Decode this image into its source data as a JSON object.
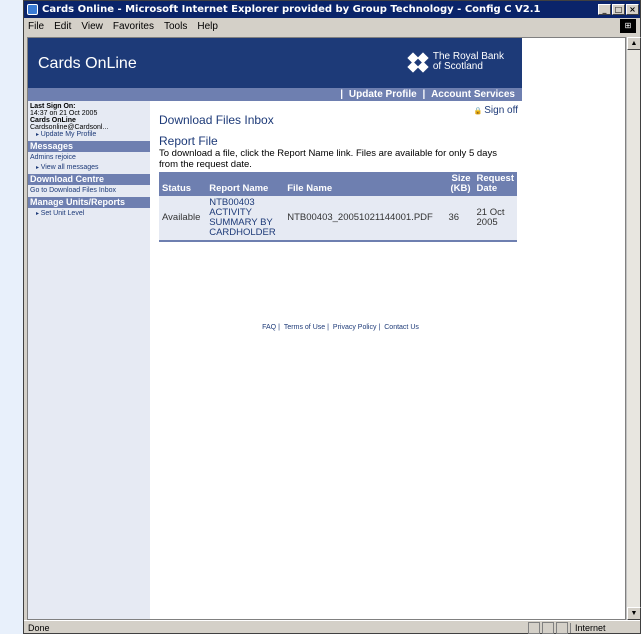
{
  "window": {
    "title": "Cards Online - Microsoft Internet Explorer provided by Group Technology - Config C V2.1"
  },
  "menu": [
    "File",
    "Edit",
    "View",
    "Favorites",
    "Tools",
    "Help"
  ],
  "header": {
    "app_name": "Cards OnLine",
    "bank_name_line1": "The Royal Bank",
    "bank_name_line2": "of Scotland"
  },
  "nav": {
    "update_profile": "Update Profile",
    "account_services": "Account Services"
  },
  "sidebar": {
    "last_sign_on_label": "Last Sign On:",
    "last_sign_on_value": "14:37 on 21 Oct 2005",
    "product": "Cards OnLine",
    "email": "Cardsonline@Cardsonl...",
    "update_my_profile": "Update My Profile",
    "messages_heading": "Messages",
    "messages_item": "Admins rejoice",
    "view_all_messages": "View all messages",
    "download_heading": "Download Centre",
    "download_link": "Go to Download Files Inbox",
    "manage_heading": "Manage Units/Reports",
    "set_unit_level": "Set Unit Level"
  },
  "main": {
    "sign_off": "Sign off",
    "page_title": "Download Files Inbox",
    "section_title": "Report File",
    "description": "To download a file, click the Report Name link. Files are available for only 5 days from the request date.",
    "table": {
      "headers": [
        "Status",
        "Report Name",
        "File Name",
        "Size (KB)",
        "Request Date"
      ],
      "rows": [
        {
          "status": "Available",
          "report_name": "NTB00403 ACTIVITY SUMMARY BY CARDHOLDER",
          "file_name": "NTB00403_20051021144001.PDF",
          "size": "36",
          "date": "21 Oct 2005"
        }
      ]
    }
  },
  "footer": {
    "links": [
      "FAQ",
      "Terms of Use",
      "Privacy Policy",
      "Contact Us"
    ]
  },
  "status": {
    "text": "Done",
    "zone": "Internet"
  }
}
